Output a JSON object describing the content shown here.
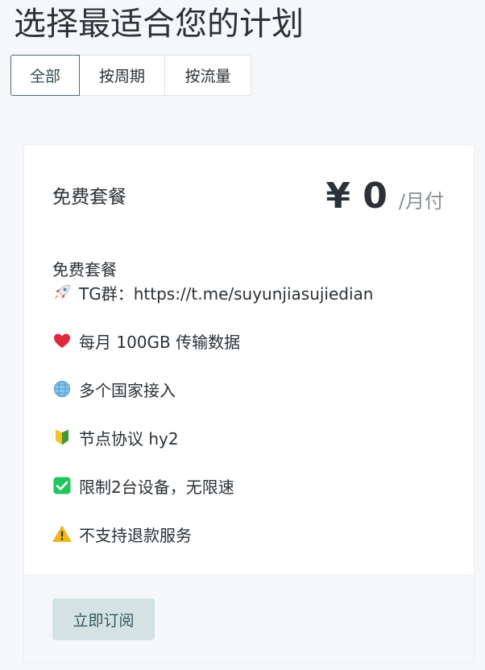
{
  "page": {
    "title": "选择最适合您的计划"
  },
  "tabs": [
    {
      "label": "全部",
      "active": true
    },
    {
      "label": "按周期",
      "active": false
    },
    {
      "label": "按流量",
      "active": false
    }
  ],
  "plan": {
    "name": "免费套餐",
    "price": "¥ 0",
    "period": "/月付",
    "description_title": "免费套餐",
    "features": [
      {
        "icon": "rocket-icon",
        "text": "TG群：https://t.me/suyunjiasujiedian"
      },
      {
        "icon": "heart-icon",
        "text": "每月 100GB 传输数据"
      },
      {
        "icon": "globe-icon",
        "text": "多个国家接入"
      },
      {
        "icon": "beginner-shield-icon",
        "text": "节点协议 hy2"
      },
      {
        "icon": "check-mark-icon",
        "text": "限制2台设备，无限速"
      },
      {
        "icon": "warning-icon",
        "text": "不支持退款服务"
      }
    ],
    "subscribe_label": "立即订阅"
  },
  "colors": {
    "background": "#f5f7fa",
    "active_tab_border": "#4a6b72",
    "button_bg": "#d4e2e3",
    "button_text": "#35585f",
    "muted_text": "#8a9197"
  }
}
